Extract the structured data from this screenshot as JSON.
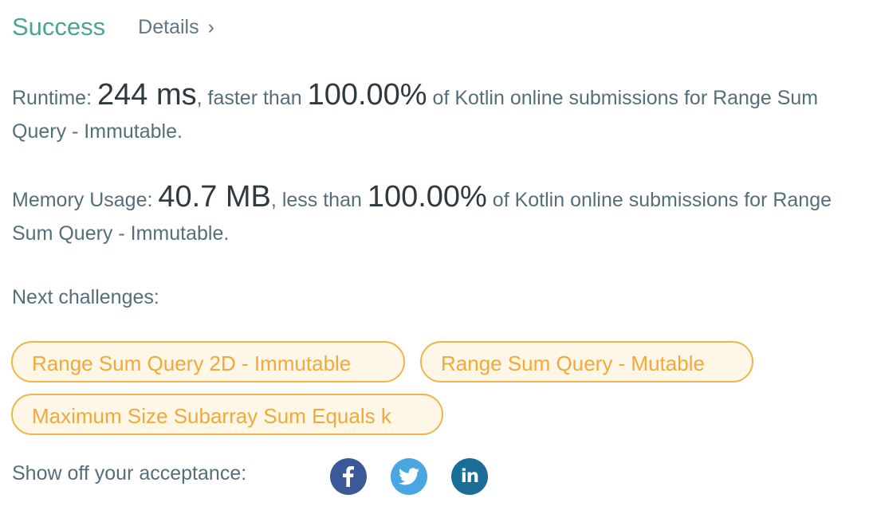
{
  "header": {
    "status": "Success",
    "details_label": "Details",
    "details_chevron": "›"
  },
  "runtime": {
    "label": "Runtime: ",
    "value": "244 ms",
    "comparison": ", faster than ",
    "percent": "100.00%",
    "suffix": " of Kotlin online submissions for Range Sum Query - Immutable."
  },
  "memory": {
    "label": "Memory Usage: ",
    "value": "40.7 MB",
    "comparison": ", less than ",
    "percent": "100.00%",
    "suffix": " of Kotlin online submissions for Range Sum Query - Immutable."
  },
  "next": {
    "label": "Next challenges:",
    "challenges": [
      "Range Sum Query 2D - Immutable",
      "Range Sum Query - Mutable",
      "Maximum Size Subarray Sum Equals k"
    ]
  },
  "share": {
    "label": "Show off your acceptance:",
    "icons": [
      "facebook-icon",
      "twitter-icon",
      "linkedin-icon"
    ],
    "linkedin_text": "in"
  },
  "colors": {
    "success": "#4aa393",
    "pill_border": "#f0b44a",
    "pill_bg": "#fef6e6",
    "pill_text": "#f0a93b",
    "facebook": "#3b5998",
    "twitter": "#4aa6e0",
    "linkedin": "#1a6d97"
  }
}
